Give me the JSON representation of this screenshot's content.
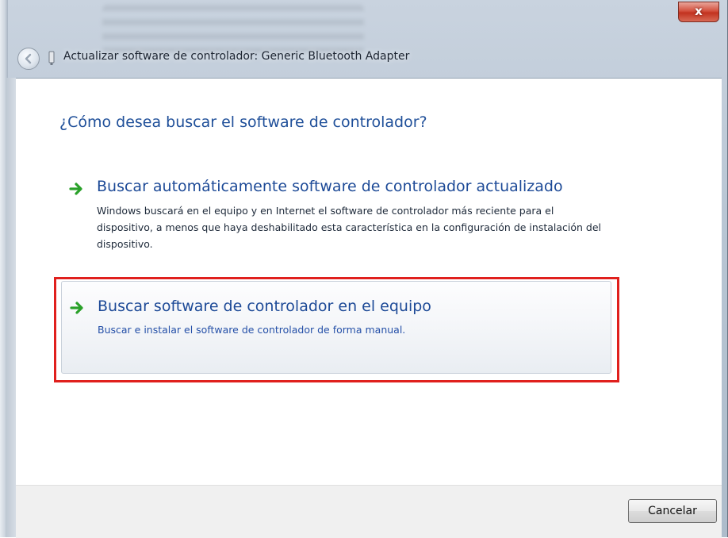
{
  "window": {
    "title": "Actualizar software de controlador: Generic Bluetooth Adapter",
    "close_label": "x"
  },
  "icons": {
    "back": "back-arrow-icon",
    "device": "device-icon",
    "option_arrow": "green-arrow-icon"
  },
  "colors": {
    "heading": "#1f4f99",
    "link": "#1d4a97",
    "highlight_frame": "#e0201d",
    "arrow_green": "#2aa12a"
  },
  "main": {
    "heading": "¿Cómo desea buscar el software de controlador?",
    "options": [
      {
        "title": "Buscar automáticamente software de controlador actualizado",
        "description": "Windows buscará en el equipo y en Internet el software de controlador más reciente para el dispositivo, a menos que haya deshabilitado esta característica en la configuración de instalación del dispositivo."
      },
      {
        "title": "Buscar software de controlador en el equipo",
        "description": "Buscar e instalar el software de controlador de forma manual."
      }
    ]
  },
  "footer": {
    "cancel_label": "Cancelar"
  }
}
